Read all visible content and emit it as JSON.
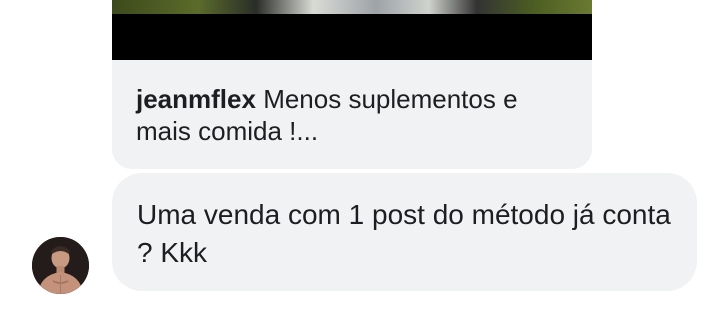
{
  "shared_post": {
    "username": "jeanmflex",
    "caption": "Menos suplementos e mais comida !..."
  },
  "message": {
    "text": "Uma venda com 1 post do método já conta ? Kkk"
  },
  "sender": {
    "avatar_icon": "user-avatar-photo"
  },
  "colors": {
    "bubble_background": "#f1f2f4",
    "text": "#1c1e21",
    "post_band": "#000000"
  }
}
